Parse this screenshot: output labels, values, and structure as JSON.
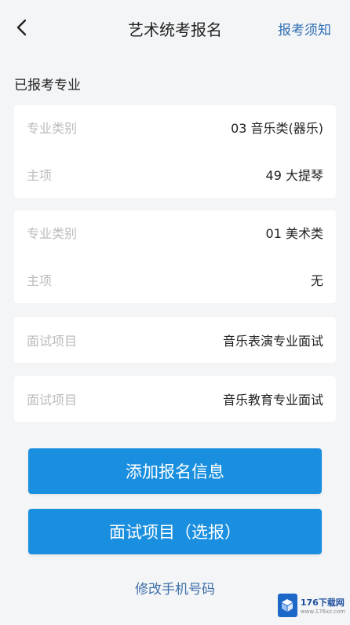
{
  "header": {
    "title": "艺术统考报名",
    "notice_link": "报考须知"
  },
  "section": {
    "title": "已报考专业"
  },
  "cards": [
    {
      "rows": [
        {
          "label": "专业类别",
          "value": "03 音乐类(器乐)"
        },
        {
          "label": "主项",
          "value": "49 大提琴"
        }
      ]
    },
    {
      "rows": [
        {
          "label": "专业类别",
          "value": "01 美术类"
        },
        {
          "label": "主项",
          "value": "无"
        }
      ]
    },
    {
      "rows": [
        {
          "label": "面试项目",
          "value": "音乐表演专业面试"
        }
      ]
    },
    {
      "rows": [
        {
          "label": "面试项目",
          "value": "音乐教育专业面试"
        }
      ]
    }
  ],
  "buttons": {
    "add_info": "添加报名信息",
    "interview": "面试项目（选报）"
  },
  "links": {
    "change_phone": "修改手机号码"
  },
  "watermark": {
    "main": "176下载网",
    "sub": "www.176xz.com"
  },
  "colors": {
    "primary": "#1a8fe0",
    "link": "#3e70aa",
    "label": "#bbbbbb",
    "background": "#f4f5f7"
  },
  "icons": {
    "back": "chevron-left-icon",
    "watermark_logo": "cube-logo-icon"
  }
}
